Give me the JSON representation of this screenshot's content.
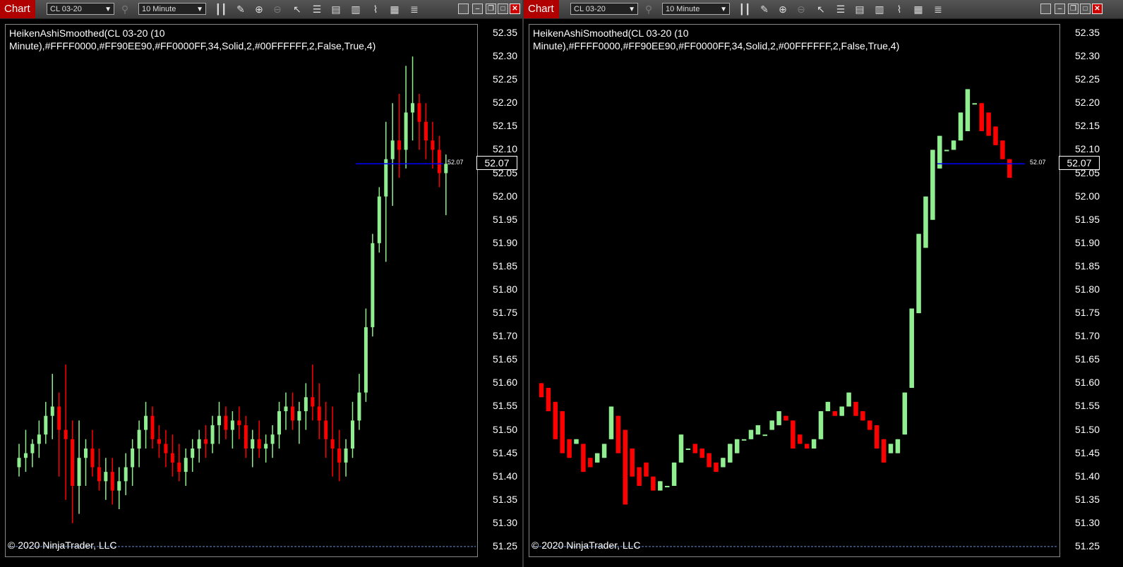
{
  "windows": [
    {
      "id": "left",
      "tab_label": "Chart",
      "instrument": "CL 03-20",
      "interval": "10 Minute",
      "indicator_title_line1": "HeikenAshiSmoothed(CL 03-20 (10",
      "indicator_title_line2": "Minute),#FFFF0000,#FF90EE90,#FF0000FF,34,Solid,2,#00FFFFFF,2,False,True,4)",
      "copyright": "© 2020 NinjaTrader, LLC",
      "price_marker": "52.07",
      "price_small": "52.07",
      "chart_data": {
        "type": "candlestick",
        "ylim": [
          51.25,
          52.35
        ],
        "y_ticks": [
          "52.35",
          "52.30",
          "52.25",
          "52.20",
          "52.15",
          "52.10",
          "52.05",
          "52.00",
          "51.95",
          "51.90",
          "51.85",
          "51.80",
          "51.75",
          "51.70",
          "51.65",
          "51.60",
          "51.55",
          "51.50",
          "51.45",
          "51.40",
          "51.35",
          "51.30",
          "51.25"
        ],
        "current_price": 52.07,
        "colors": {
          "up": "#90EE90",
          "down": "#FF0000",
          "price_line": "#0000FF"
        },
        "candles": [
          [
            51.42,
            51.47,
            51.4,
            51.44
          ],
          [
            51.44,
            51.5,
            51.41,
            51.45
          ],
          [
            51.45,
            51.48,
            51.42,
            51.47
          ],
          [
            51.47,
            51.52,
            51.44,
            51.49
          ],
          [
            51.49,
            51.56,
            51.47,
            51.53
          ],
          [
            51.53,
            51.62,
            51.48,
            51.55
          ],
          [
            51.55,
            51.58,
            51.4,
            51.5
          ],
          [
            51.5,
            51.64,
            51.35,
            51.48
          ],
          [
            51.48,
            51.52,
            51.3,
            51.38
          ],
          [
            51.38,
            51.52,
            51.32,
            51.44
          ],
          [
            51.44,
            51.48,
            51.38,
            51.46
          ],
          [
            51.46,
            51.5,
            51.4,
            51.42
          ],
          [
            51.42,
            51.46,
            51.37,
            51.39
          ],
          [
            51.39,
            51.44,
            51.35,
            51.41
          ],
          [
            51.41,
            51.44,
            51.34,
            51.37
          ],
          [
            51.37,
            51.42,
            51.33,
            51.39
          ],
          [
            51.39,
            51.45,
            51.36,
            51.42
          ],
          [
            51.42,
            51.48,
            51.38,
            51.46
          ],
          [
            51.46,
            51.52,
            51.42,
            51.5
          ],
          [
            51.5,
            51.56,
            51.46,
            51.53
          ],
          [
            51.53,
            51.55,
            51.46,
            51.48
          ],
          [
            51.48,
            51.51,
            51.44,
            51.47
          ],
          [
            51.47,
            51.5,
            51.42,
            51.45
          ],
          [
            51.45,
            51.49,
            51.4,
            51.43
          ],
          [
            51.43,
            51.47,
            51.39,
            51.41
          ],
          [
            51.41,
            51.46,
            51.38,
            51.44
          ],
          [
            51.44,
            51.48,
            51.41,
            51.46
          ],
          [
            51.46,
            51.5,
            51.43,
            51.48
          ],
          [
            51.48,
            51.51,
            51.44,
            51.47
          ],
          [
            51.47,
            51.53,
            51.45,
            51.51
          ],
          [
            51.51,
            51.56,
            51.47,
            51.53
          ],
          [
            51.53,
            51.55,
            51.48,
            51.5
          ],
          [
            51.5,
            51.54,
            51.46,
            51.52
          ],
          [
            51.52,
            51.55,
            51.48,
            51.51
          ],
          [
            51.51,
            51.53,
            51.44,
            51.46
          ],
          [
            51.46,
            51.5,
            51.42,
            51.48
          ],
          [
            51.48,
            51.52,
            51.44,
            51.46
          ],
          [
            51.46,
            51.49,
            51.43,
            51.47
          ],
          [
            51.47,
            51.51,
            51.44,
            51.49
          ],
          [
            51.49,
            51.56,
            51.46,
            51.54
          ],
          [
            51.54,
            51.58,
            51.5,
            51.55
          ],
          [
            51.55,
            51.58,
            51.5,
            51.52
          ],
          [
            51.52,
            51.56,
            51.47,
            51.54
          ],
          [
            51.54,
            51.6,
            51.5,
            51.57
          ],
          [
            51.57,
            51.64,
            51.52,
            51.55
          ],
          [
            51.55,
            51.6,
            51.48,
            51.52
          ],
          [
            51.52,
            51.56,
            51.44,
            51.48
          ],
          [
            51.48,
            51.55,
            51.4,
            51.46
          ],
          [
            51.46,
            51.5,
            51.39,
            51.43
          ],
          [
            51.43,
            51.48,
            51.4,
            51.46
          ],
          [
            51.46,
            51.56,
            51.44,
            51.52
          ],
          [
            51.52,
            51.62,
            51.5,
            51.58
          ],
          [
            51.58,
            51.76,
            51.56,
            51.72
          ],
          [
            51.72,
            51.92,
            51.7,
            51.9
          ],
          [
            51.9,
            52.02,
            51.88,
            52.0
          ],
          [
            52.0,
            52.16,
            51.86,
            52.08
          ],
          [
            52.08,
            52.2,
            51.98,
            52.12
          ],
          [
            52.12,
            52.22,
            52.04,
            52.1
          ],
          [
            52.1,
            52.28,
            52.06,
            52.18
          ],
          [
            52.18,
            52.3,
            52.12,
            52.2
          ],
          [
            52.2,
            52.22,
            52.1,
            52.16
          ],
          [
            52.16,
            52.2,
            52.08,
            52.12
          ],
          [
            52.12,
            52.16,
            52.06,
            52.1
          ],
          [
            52.1,
            52.13,
            52.02,
            52.05
          ],
          [
            52.05,
            52.09,
            51.96,
            52.07
          ]
        ]
      }
    },
    {
      "id": "right",
      "tab_label": "Chart",
      "instrument": "CL 03-20",
      "interval": "10 Minute",
      "indicator_title_line1": "HeikenAshiSmoothed(CL 03-20 (10",
      "indicator_title_line2": "Minute),#FFFF0000,#FF90EE90,#FF0000FF,34,Solid,2,#00FFFFFF,2,False,True,4)",
      "copyright": "© 2020 NinjaTrader, LLC",
      "price_marker": "52.07",
      "price_small": "52.07",
      "chart_data": {
        "type": "candlestick",
        "ylim": [
          51.25,
          52.35
        ],
        "y_ticks": [
          "52.35",
          "52.30",
          "52.25",
          "52.20",
          "52.15",
          "52.10",
          "52.05",
          "52.00",
          "51.95",
          "51.90",
          "51.85",
          "51.80",
          "51.75",
          "51.70",
          "51.65",
          "51.60",
          "51.55",
          "51.50",
          "51.45",
          "51.40",
          "51.35",
          "51.30",
          "51.25"
        ],
        "current_price": 52.07,
        "colors": {
          "up": "#90EE90",
          "down": "#FF0000",
          "price_line": "#0000FF"
        },
        "candles": [
          [
            51.6,
            51.6,
            51.57,
            51.57
          ],
          [
            51.59,
            51.59,
            51.54,
            51.54
          ],
          [
            51.56,
            51.56,
            51.48,
            51.48
          ],
          [
            51.54,
            51.54,
            51.45,
            51.45
          ],
          [
            51.48,
            51.48,
            51.44,
            51.44
          ],
          [
            51.47,
            51.48,
            51.47,
            51.48
          ],
          [
            51.47,
            51.47,
            51.41,
            51.41
          ],
          [
            51.44,
            51.44,
            51.42,
            51.42
          ],
          [
            51.43,
            51.45,
            51.43,
            51.45
          ],
          [
            51.44,
            51.47,
            51.44,
            51.47
          ],
          [
            51.48,
            51.55,
            51.48,
            51.55
          ],
          [
            51.53,
            51.53,
            51.45,
            51.45
          ],
          [
            51.5,
            51.5,
            51.34,
            51.34
          ],
          [
            51.46,
            51.46,
            51.4,
            51.4
          ],
          [
            51.42,
            51.42,
            51.38,
            51.38
          ],
          [
            51.43,
            51.43,
            51.4,
            51.4
          ],
          [
            51.4,
            51.4,
            51.37,
            51.37
          ],
          [
            51.37,
            51.39,
            51.37,
            51.39
          ],
          [
            51.38,
            51.38,
            51.38,
            51.38
          ],
          [
            51.38,
            51.43,
            51.38,
            51.43
          ],
          [
            51.43,
            51.49,
            51.43,
            51.49
          ],
          [
            51.46,
            51.46,
            51.46,
            51.46
          ],
          [
            51.47,
            51.47,
            51.45,
            51.45
          ],
          [
            51.46,
            51.46,
            51.44,
            51.44
          ],
          [
            51.45,
            51.45,
            51.42,
            51.42
          ],
          [
            51.43,
            51.43,
            51.41,
            51.41
          ],
          [
            51.42,
            51.44,
            51.42,
            51.44
          ],
          [
            51.43,
            51.47,
            51.43,
            51.47
          ],
          [
            51.45,
            51.48,
            51.45,
            51.48
          ],
          [
            51.48,
            51.48,
            51.48,
            51.48
          ],
          [
            51.48,
            51.5,
            51.48,
            51.5
          ],
          [
            51.49,
            51.51,
            51.49,
            51.51
          ],
          [
            51.49,
            51.49,
            51.49,
            51.49
          ],
          [
            51.5,
            51.52,
            51.5,
            51.52
          ],
          [
            51.51,
            51.54,
            51.51,
            51.54
          ],
          [
            51.53,
            51.53,
            51.52,
            51.52
          ],
          [
            51.52,
            51.52,
            51.46,
            51.46
          ],
          [
            51.49,
            51.49,
            51.47,
            51.47
          ],
          [
            51.47,
            51.47,
            51.46,
            51.46
          ],
          [
            51.46,
            51.48,
            51.46,
            51.48
          ],
          [
            51.48,
            51.54,
            51.48,
            51.54
          ],
          [
            51.54,
            51.56,
            51.54,
            51.56
          ],
          [
            51.54,
            51.54,
            51.53,
            51.53
          ],
          [
            51.53,
            51.55,
            51.53,
            51.55
          ],
          [
            51.55,
            51.58,
            51.55,
            51.58
          ],
          [
            51.56,
            51.56,
            51.53,
            51.53
          ],
          [
            51.54,
            51.54,
            51.52,
            51.52
          ],
          [
            51.52,
            51.52,
            51.5,
            51.5
          ],
          [
            51.51,
            51.51,
            51.46,
            51.46
          ],
          [
            51.48,
            51.48,
            51.43,
            51.43
          ],
          [
            51.45,
            51.47,
            51.45,
            51.47
          ],
          [
            51.45,
            51.48,
            51.45,
            51.48
          ],
          [
            51.49,
            51.58,
            51.49,
            51.58
          ],
          [
            51.59,
            51.76,
            51.59,
            51.76
          ],
          [
            51.75,
            51.92,
            51.75,
            51.92
          ],
          [
            51.89,
            52.0,
            51.89,
            52.0
          ],
          [
            51.95,
            52.1,
            51.95,
            52.1
          ],
          [
            52.06,
            52.13,
            52.06,
            52.13
          ],
          [
            52.1,
            52.1,
            52.1,
            52.1
          ],
          [
            52.1,
            52.12,
            52.1,
            52.12
          ],
          [
            52.12,
            52.18,
            52.12,
            52.18
          ],
          [
            52.14,
            52.23,
            52.14,
            52.23
          ],
          [
            52.2,
            52.2,
            52.2,
            52.2
          ],
          [
            52.2,
            52.2,
            52.14,
            52.14
          ],
          [
            52.18,
            52.18,
            52.13,
            52.13
          ],
          [
            52.15,
            52.15,
            52.11,
            52.11
          ],
          [
            52.12,
            52.12,
            52.08,
            52.08
          ],
          [
            52.08,
            52.08,
            52.04,
            52.04
          ]
        ]
      }
    }
  ]
}
